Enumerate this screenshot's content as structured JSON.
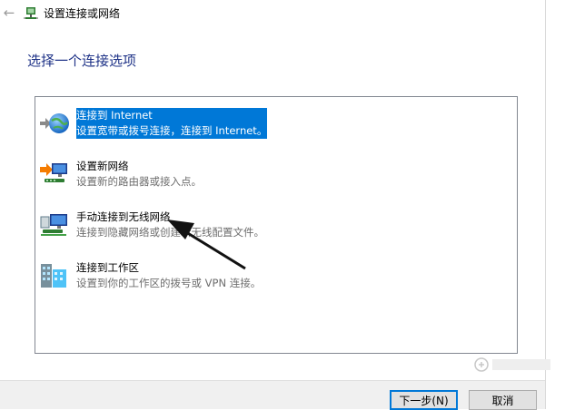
{
  "window": {
    "title": "设置连接或网络",
    "back_icon": "back-arrow-icon",
    "title_icon": "network-setup-icon"
  },
  "heading": "选择一个连接选项",
  "options": [
    {
      "title": "连接到 Internet",
      "desc": "设置宽带或拨号连接，连接到 Internet。",
      "icon": "globe-network-icon",
      "selected": true
    },
    {
      "title": "设置新网络",
      "desc": "设置新的路由器或接入点。",
      "icon": "new-network-icon",
      "selected": false
    },
    {
      "title": "手动连接到无线网络",
      "desc": "连接到隐藏网络或创建新无线配置文件。",
      "icon": "wireless-network-icon",
      "selected": false
    },
    {
      "title": "连接到工作区",
      "desc": "设置到你的工作区的拨号或 VPN 连接。",
      "icon": "workplace-icon",
      "selected": false
    }
  ],
  "buttons": {
    "next": "下一步(N)",
    "cancel": "取消"
  },
  "colors": {
    "selection": "#0078d7",
    "heading": "#1e3287",
    "footer": "#f0f0f0"
  }
}
